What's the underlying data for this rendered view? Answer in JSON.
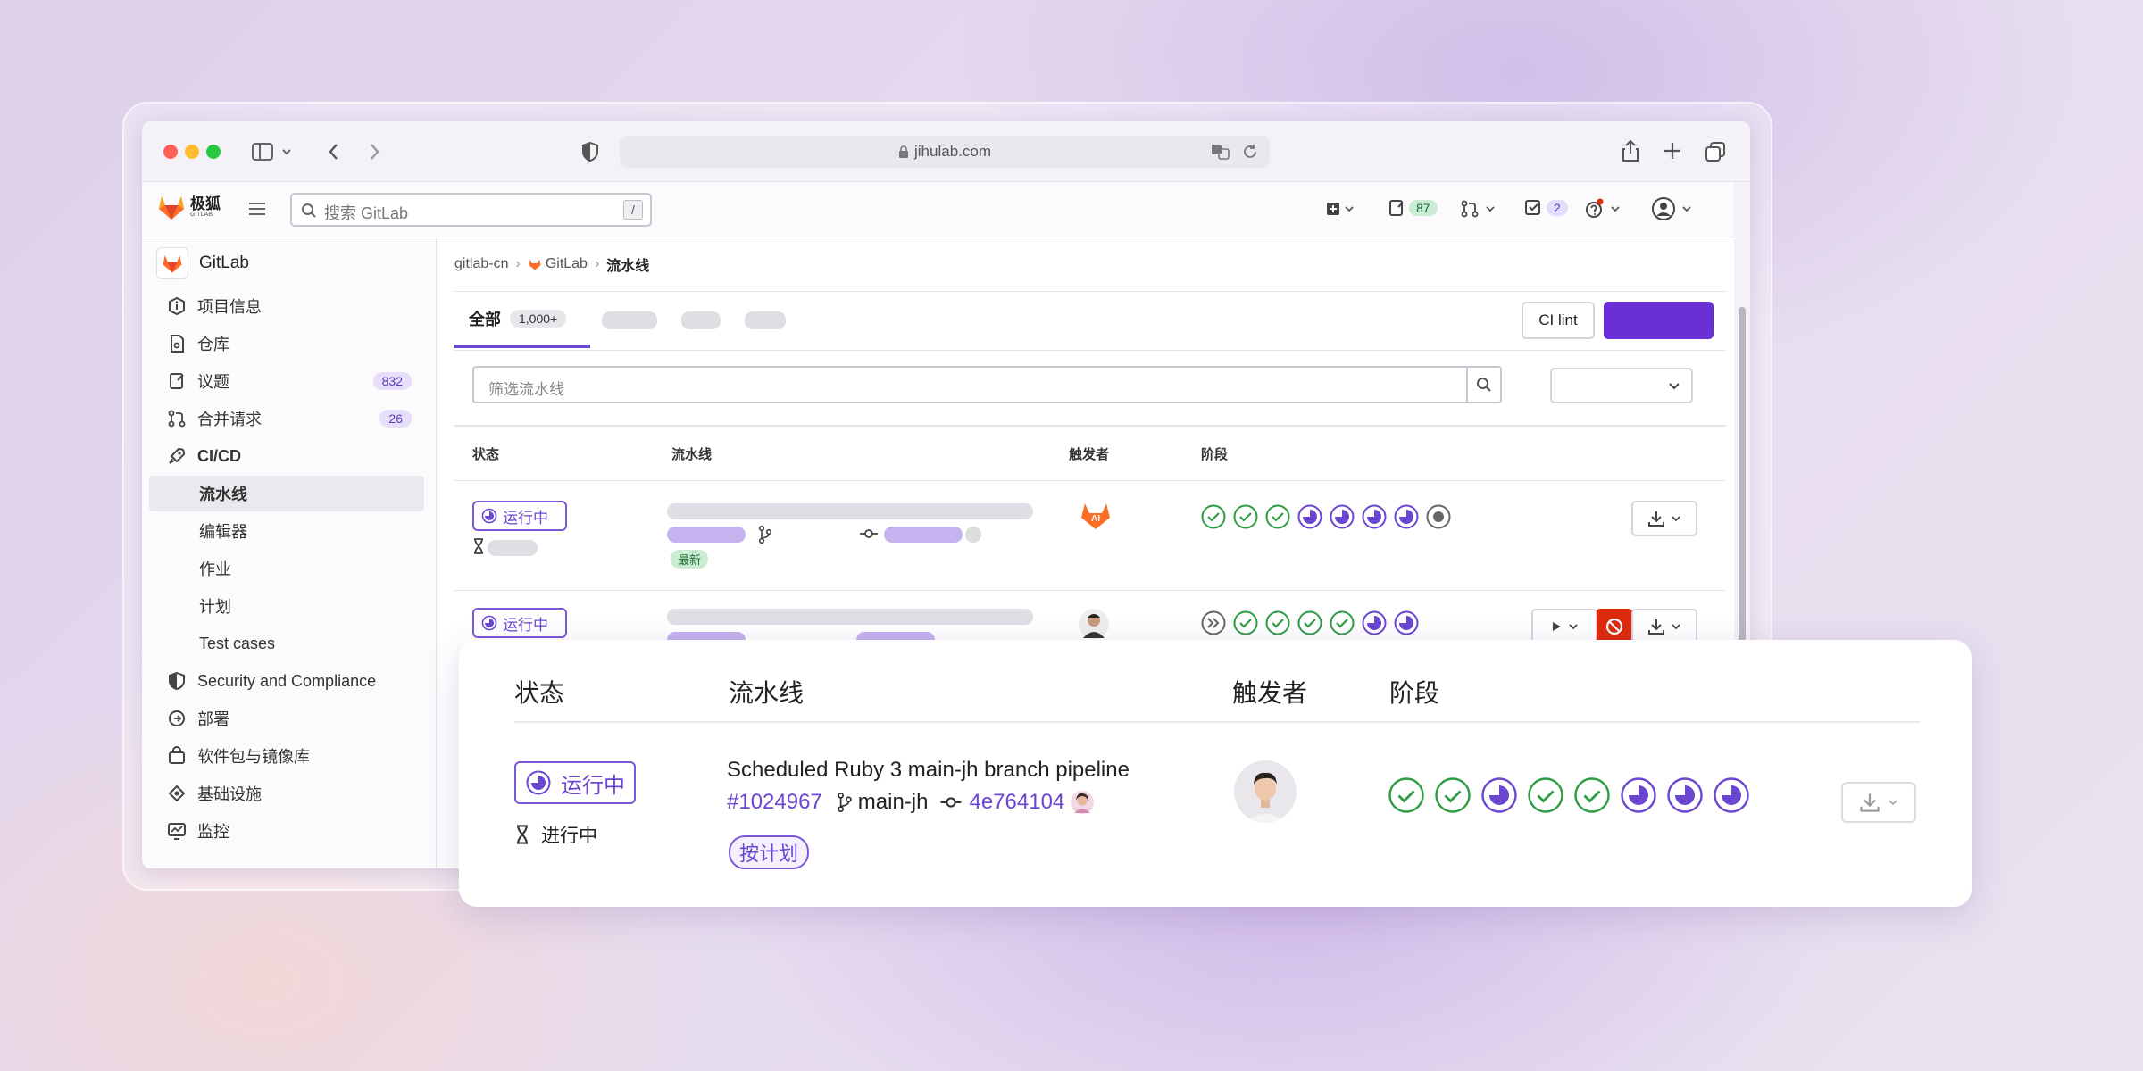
{
  "browser": {
    "url": "jihulab.com"
  },
  "header": {
    "logo_text": "极狐",
    "logo_sub": "GITLAB",
    "search_placeholder": "搜索 GitLab",
    "search_shortcut": "/",
    "issues_count": "87",
    "todos_count": "2"
  },
  "sidebar": {
    "project_name": "GitLab",
    "items": [
      {
        "label": "项目信息",
        "icon": "info-icon"
      },
      {
        "label": "仓库",
        "icon": "repo-icon"
      },
      {
        "label": "议题",
        "icon": "issues-icon",
        "count": "832"
      },
      {
        "label": "合并请求",
        "icon": "merge-request-icon",
        "count": "26"
      },
      {
        "label": "CI/CD",
        "icon": "rocket-icon"
      }
    ],
    "cicd_sub": [
      "流水线",
      "编辑器",
      "作业",
      "计划",
      "Test cases"
    ],
    "items_after": [
      {
        "label": "Security and Compliance",
        "icon": "shield-icon"
      },
      {
        "label": "部署",
        "icon": "deploy-icon"
      },
      {
        "label": "软件包与镜像库",
        "icon": "package-icon"
      },
      {
        "label": "基础设施",
        "icon": "infrastructure-icon"
      },
      {
        "label": "监控",
        "icon": "monitor-icon"
      }
    ]
  },
  "breadcrumb": [
    "gitlab-cn",
    "GitLab",
    "流水线"
  ],
  "tabs": {
    "all_label": "全部",
    "all_count": "1,000+"
  },
  "actions": {
    "ci_lint": "CI lint"
  },
  "filter": {
    "placeholder": "筛选流水线"
  },
  "table": {
    "headers": [
      "状态",
      "流水线",
      "触发者",
      "阶段"
    ],
    "rows": [
      {
        "status": "运行中",
        "badge": "最新"
      },
      {
        "status": "运行中"
      }
    ]
  },
  "card": {
    "headers": [
      "状态",
      "流水线",
      "触发者",
      "阶段"
    ],
    "status": "运行中",
    "duration_label": "进行中",
    "title": "Scheduled Ruby 3 main-jh branch pipeline",
    "pipeline_id": "#1024967",
    "branch": "main-jh",
    "commit": "4e764104",
    "schedule_badge": "按计划",
    "stages": [
      "success",
      "success",
      "running",
      "success",
      "success",
      "running",
      "running",
      "running"
    ]
  },
  "colors": {
    "accent": "#6b46d0",
    "success": "#2e9c43",
    "danger": "#dd2b0e"
  }
}
